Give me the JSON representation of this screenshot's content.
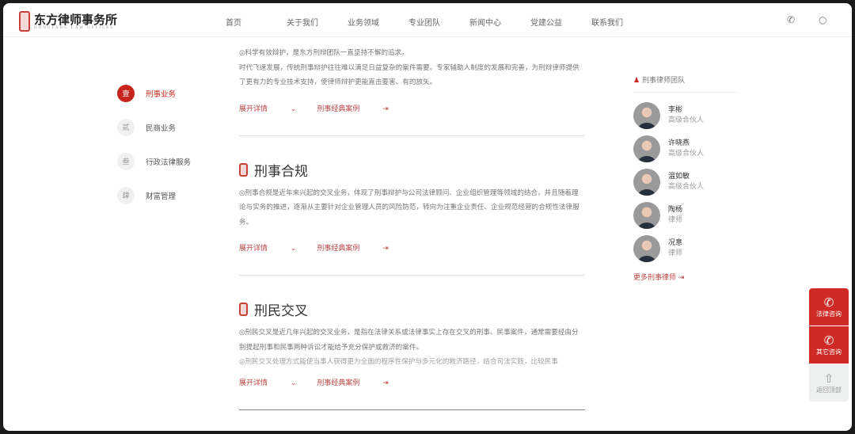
{
  "header": {
    "logo_cn": "东方律师事务所",
    "logo_en": "DONGFANG LAW OFFICES",
    "nav": [
      "首页",
      "关于我们",
      "业务领域",
      "专业团队",
      "新闻中心",
      "党建公益",
      "联系我们"
    ],
    "phone_icon": "phone-icon",
    "search_icon": "search-icon"
  },
  "side_nav": [
    {
      "num": "壹",
      "label": "刑事业务"
    },
    {
      "num": "贰",
      "label": "民商业务"
    },
    {
      "num": "叁",
      "label": "行政法律服务"
    },
    {
      "num": "肆",
      "label": "财富管理"
    }
  ],
  "sections": [
    {
      "paragraphs": [
        "◎科学有效辩护，是东方刑辩团队一直坚持不懈的追求。",
        "时代飞速发展，传统刑事辩护往往难以满足日益复杂的案件需要。专家辅助人制度的发展和完善，为刑辩律师提供了更有力的专业技术支持，使律师辩护更能直击要害、有的放矢。"
      ],
      "expand": "展开详情",
      "cases": "刑事经典案例"
    },
    {
      "title": "刑事合规",
      "paragraphs": [
        "◎刑事合规是近年来兴起的交叉业务，体现了刑事辩护与公司法律顾问、企业组织管理等领域的结合，并且随着理论与实务的推进，逐渐从主要针对企业管理人员的风险防范，转向为注重企业责任、企业规范经营的合规性法律服务。"
      ],
      "expand": "展开详情",
      "cases": "刑事经典案例"
    },
    {
      "title": "刑民交叉",
      "paragraphs": [
        "◎刑民交叉是近几年兴起的交叉业务，是指在法律关系或法律事实上存在交叉的刑事、民事案件，通常需要经由分别提起刑事和民事两种诉讼才能给予充分保护或救济的案件。",
        "◎刑民交叉处理方式能使当事人获得更为全面的程序性保护与多元化的救济路径，结合司法实践，比较民事"
      ],
      "expand": "展开详情",
      "cases": "刑事经典案例"
    }
  ],
  "team": {
    "title": "刑事律师团队",
    "members": [
      {
        "name": "李彬",
        "role": "高级合伙人"
      },
      {
        "name": "许晓燕",
        "role": "高级合伙人"
      },
      {
        "name": "温如敏",
        "role": "高级合伙人"
      },
      {
        "name": "陶杨",
        "role": "律师"
      },
      {
        "name": "况意",
        "role": "律师"
      }
    ],
    "more": "更多刑事律师"
  },
  "float": {
    "legal": "法律咨询",
    "other": "其它咨询",
    "top": "返回顶部"
  },
  "colors": {
    "accent": "#c7241e"
  }
}
